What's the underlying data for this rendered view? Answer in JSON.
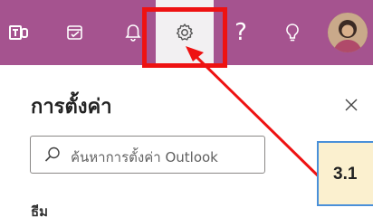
{
  "topbar": {
    "background": "#a5538f",
    "buttons": [
      {
        "icon": "teams-icon"
      },
      {
        "icon": "todo-icon"
      },
      {
        "icon": "bell-icon"
      },
      {
        "icon": "gear-icon",
        "active": true
      },
      {
        "icon": "help-icon",
        "glyph": "?"
      },
      {
        "icon": "lightbulb-icon"
      },
      {
        "icon": "avatar"
      }
    ]
  },
  "settings_panel": {
    "title": "การตั้งค่า",
    "search_placeholder": "ค้นหาการตั้งค่า Outlook",
    "section_label": "ธีม"
  },
  "annotation": {
    "highlight_color": "#ee1212",
    "arrow_color": "#ee1212",
    "step_label": "3.1",
    "callout_fill": "#fbf0cf",
    "callout_border": "#4a90d9"
  }
}
